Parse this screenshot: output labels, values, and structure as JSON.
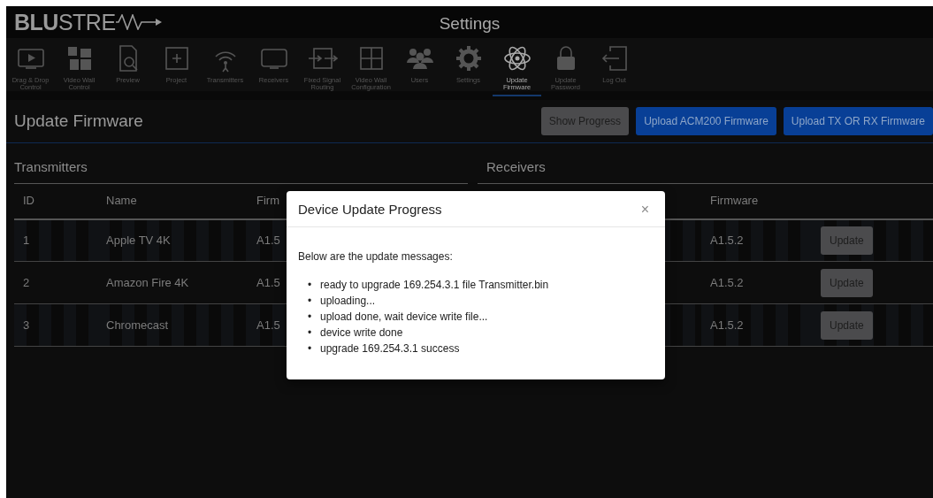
{
  "header": {
    "logo": "**BLU**STRE",
    "title": "Settings"
  },
  "nav": [
    {
      "label": "Drag & Drop Control",
      "kind": "screen-play",
      "selected": false
    },
    {
      "label": "Video Wall Control",
      "kind": "tiles",
      "selected": false
    },
    {
      "label": "Preview",
      "kind": "document",
      "selected": false
    },
    {
      "label": "Project",
      "kind": "plus",
      "selected": false
    },
    {
      "label": "Transmitters",
      "kind": "antenna",
      "selected": false
    },
    {
      "label": "Receivers",
      "kind": "monitor",
      "selected": false
    },
    {
      "label": "Fixed Signal Routing",
      "kind": "routing",
      "selected": false
    },
    {
      "label": "Video Wall Configuration",
      "kind": "grid",
      "selected": false
    },
    {
      "label": "Users",
      "kind": "users",
      "selected": false
    },
    {
      "label": "Settings",
      "kind": "gear",
      "selected": false
    },
    {
      "label": "Update Firmware",
      "kind": "atom",
      "selected": true
    },
    {
      "label": "Update Password",
      "kind": "lock",
      "selected": false
    },
    {
      "label": "Log Out",
      "kind": "logout",
      "selected": false
    }
  ],
  "page": {
    "title": "Update Firmware",
    "buttons": [
      {
        "label": "Show Progress",
        "kind": "secondary"
      },
      {
        "label": "Upload ACM200 Firmware",
        "kind": "primary"
      },
      {
        "label": "Upload TX OR RX Firmware",
        "kind": "primary"
      }
    ]
  },
  "transmitters": {
    "title": "Transmitters",
    "columns": [
      "ID",
      "Name",
      "Firm"
    ],
    "rows": [
      {
        "id": "1",
        "name": "Apple TV 4K",
        "firmware": "A1.5"
      },
      {
        "id": "2",
        "name": "Amazon Fire 4K",
        "firmware": "A1.5"
      },
      {
        "id": "3",
        "name": "Chromecast",
        "firmware": "A1.5"
      }
    ]
  },
  "receivers": {
    "title": "Receivers",
    "columns": [
      "Firmware"
    ],
    "rows": [
      {
        "firmware": "A1.5.2",
        "action": "Update"
      },
      {
        "firmware": "A1.5.2",
        "action": "Update"
      },
      {
        "firmware": "A1.5.2",
        "action": "Update"
      }
    ]
  },
  "modal": {
    "title": "Device Update Progress",
    "close": "×",
    "intro": "Below are the update messages:",
    "messages": [
      {
        "bullet": "•",
        "text": "ready to upgrade 169.254.3.1 file Transmitter.bin"
      },
      {
        "bullet": "•",
        "text": "uploading..."
      },
      {
        "bullet": "•",
        "text": "upload done, wait device write file..."
      },
      {
        "bullet": "•",
        "text": "device write done"
      },
      {
        "bullet": "•",
        "text": "upgrade 169.254.3.1 success"
      }
    ]
  }
}
